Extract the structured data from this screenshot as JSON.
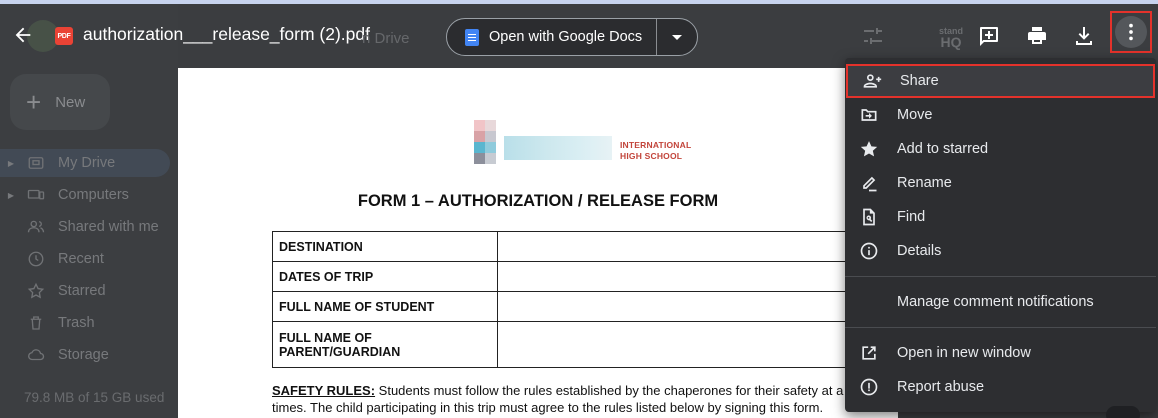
{
  "header": {
    "file_title": "authorization___release_form (2).pdf",
    "ghost_title_suffix": "n Drive",
    "pdf_badge": "PDF",
    "open_with_label": "Open with Google Docs",
    "stand_icon_line1": "stand",
    "stand_icon_line2": "HQ"
  },
  "drive_sidebar": {
    "new_label": "New",
    "items": [
      {
        "label": "My Drive",
        "icon": "my-drive-icon"
      },
      {
        "label": "Computers",
        "icon": "computer-icon"
      },
      {
        "label": "Shared with me",
        "icon": "people-icon"
      },
      {
        "label": "Recent",
        "icon": "clock-icon"
      },
      {
        "label": "Starred",
        "icon": "star-outline-icon"
      },
      {
        "label": "Trash",
        "icon": "trash-icon"
      },
      {
        "label": "Storage",
        "icon": "cloud-icon"
      }
    ],
    "storage_text": "79.8 MB of 15 GB used"
  },
  "document": {
    "logo_line1": "INTERNATIONAL",
    "logo_line2": "HIGH SCHOOL",
    "title": "FORM 1 – AUTHORIZATION / RELEASE FORM",
    "table_rows": [
      {
        "label": "DESTINATION",
        "value": ""
      },
      {
        "label": "DATES OF TRIP",
        "value": ""
      },
      {
        "label": "FULL NAME OF STUDENT",
        "value": ""
      },
      {
        "label": "FULL NAME OF PARENT/GUARDIAN",
        "value": ""
      }
    ],
    "safety_heading": "SAFETY RULES:",
    "safety_text": " Students must follow the rules established by the chaperones for their safety at a",
    "safety_text_line2": "times. The child participating in this trip must agree to the rules listed below by signing this form."
  },
  "menu": {
    "items": [
      {
        "label": "Share",
        "icon": "person-add-icon"
      },
      {
        "label": "Move",
        "icon": "move-folder-icon"
      },
      {
        "label": "Add to starred",
        "icon": "star-icon"
      },
      {
        "label": "Rename",
        "icon": "pencil-icon"
      },
      {
        "label": "Find",
        "icon": "find-in-page-icon"
      },
      {
        "label": "Details",
        "icon": "info-icon"
      },
      {
        "label": "Manage comment notifications",
        "icon": ""
      },
      {
        "label": "Open in new window",
        "icon": "open-in-new-icon"
      },
      {
        "label": "Report abuse",
        "icon": "report-icon"
      }
    ]
  },
  "colors": {
    "highlight_border": "#e4322b",
    "menu_bg": "#2d2e31",
    "pdf_badge": "#ea4335",
    "docs_blue": "#4285f4"
  }
}
